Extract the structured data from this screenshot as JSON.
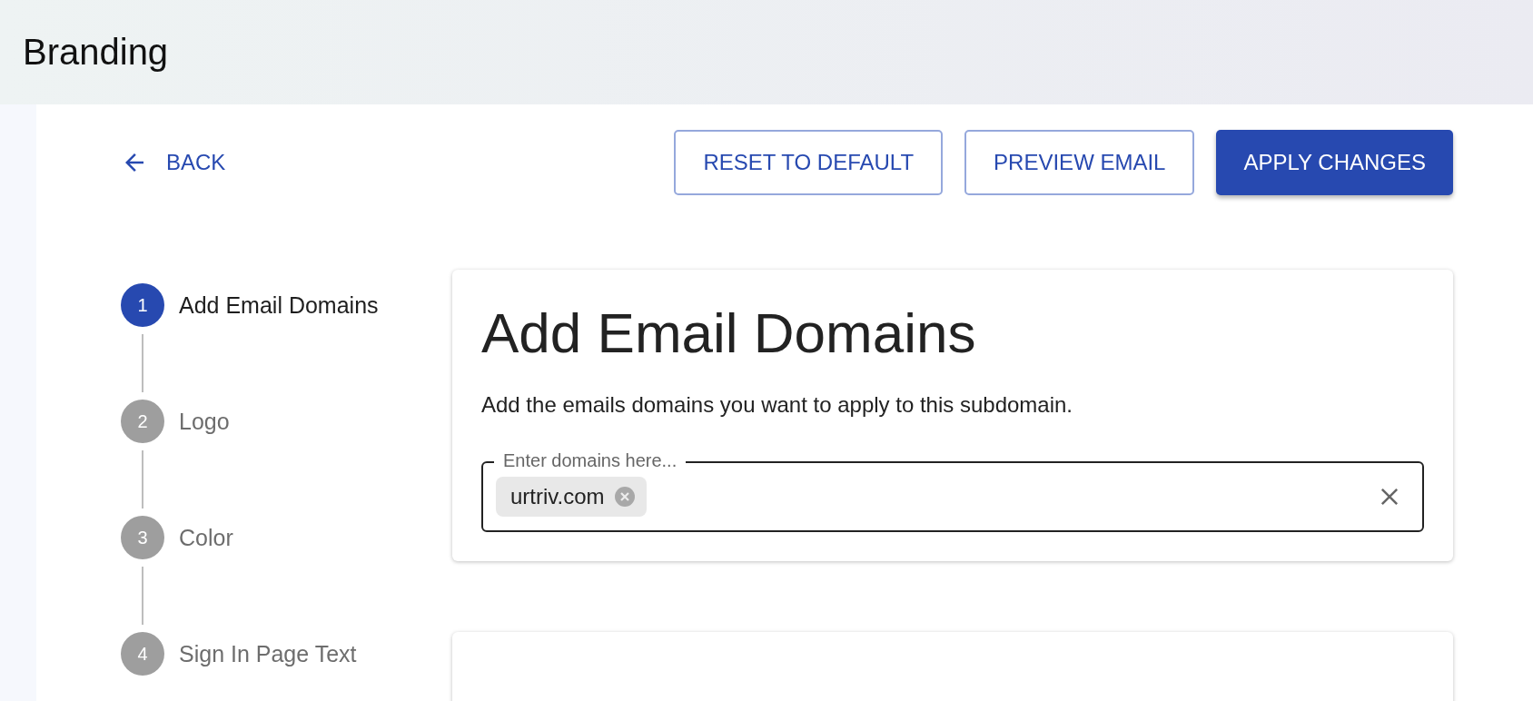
{
  "header": {
    "title": "Branding"
  },
  "back": {
    "label": "BACK"
  },
  "actions": [
    {
      "label": "RESET TO DEFAULT",
      "kind": "outlined"
    },
    {
      "label": "PREVIEW EMAIL",
      "kind": "outlined"
    },
    {
      "label": "APPLY CHANGES",
      "kind": "contained"
    }
  ],
  "steps": [
    {
      "number": "1",
      "label": "Add Email Domains",
      "selected": true
    },
    {
      "number": "2",
      "label": "Logo",
      "selected": false
    },
    {
      "number": "3",
      "label": "Color",
      "selected": false
    },
    {
      "number": "4",
      "label": "Sign In Page Text",
      "selected": false
    }
  ],
  "domains_card": {
    "title": "Add Email Domains",
    "description": "Add the emails domains you want to apply to this subdomain.",
    "field": {
      "label": "Enter domains here...",
      "chips": [
        "urtriv.com"
      ]
    }
  }
}
